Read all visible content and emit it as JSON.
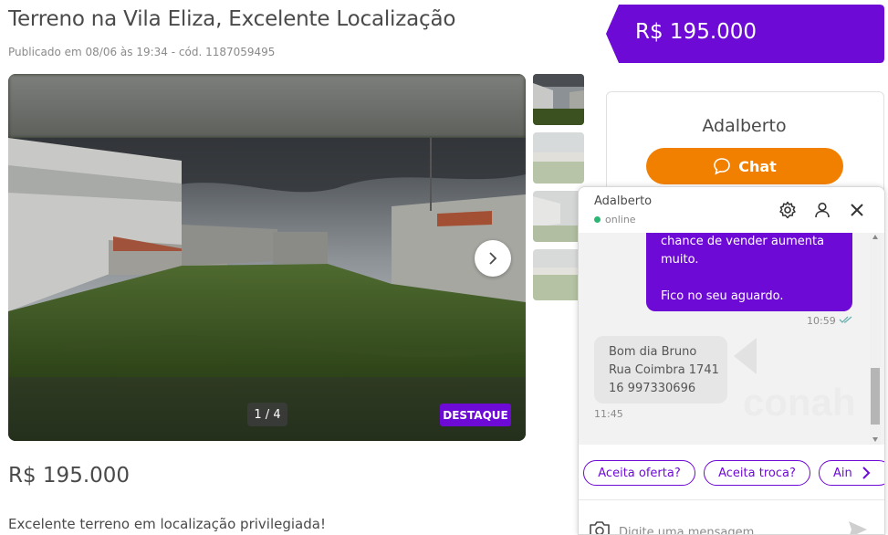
{
  "listing": {
    "title": "Terreno na Vila Eliza, Excelente Localização",
    "meta": "Publicado em 08/06 às 19:34 - cód. 1187059495",
    "price": "R$ 195.000",
    "description": "Excelente terreno em localização privilegiada!"
  },
  "gallery": {
    "counter": "1 / 4",
    "badge": "DESTAQUE",
    "thumbnail_count": 4,
    "icons": {
      "next": "chevron-right-icon"
    }
  },
  "price_banner": {
    "text": "R$ 195.000",
    "color": "#6e0ad6"
  },
  "seller": {
    "name": "Adalberto",
    "chat_button_label": "Chat",
    "chat_button_color": "#f28000"
  },
  "chat": {
    "contact_name": "Adalberto",
    "status": "online",
    "messages": [
      {
        "direction": "out",
        "lines": [
          "chance de vender aumenta",
          "muito.",
          "",
          "Fico no seu aguardo."
        ],
        "time": "10:59"
      },
      {
        "direction": "in",
        "lines": [
          "Bom dia Bruno",
          "Rua Coimbra 1741",
          "16 997330696"
        ],
        "time": "11:45"
      }
    ],
    "suggestions": [
      "Aceita oferta?",
      "Aceita troca?",
      "Ain"
    ],
    "input_placeholder": "Digite uma mensagem...",
    "icons": {
      "settings": "gear-icon",
      "profile": "user-icon",
      "close": "close-icon",
      "camera": "camera-icon",
      "send": "send-icon",
      "more": "chevron-right-icon"
    }
  }
}
